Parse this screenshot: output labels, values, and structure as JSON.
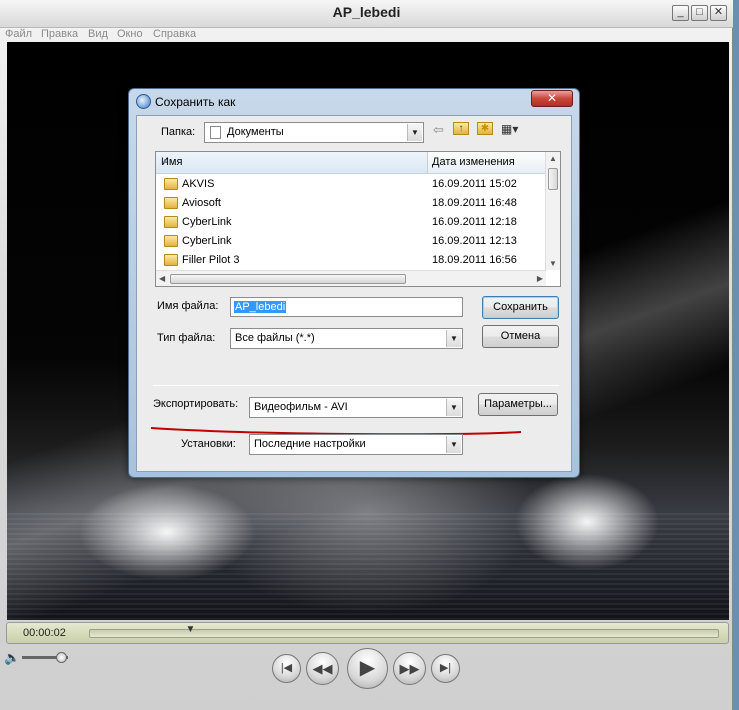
{
  "window": {
    "title": "AP_lebedi",
    "minimize": "_",
    "maximize": "□",
    "close": "✕"
  },
  "menu": [
    "Файл",
    "Правка",
    "Вид",
    "Окно",
    "Справка"
  ],
  "player": {
    "time": "00:00:02",
    "progress_fraction": 0.16,
    "volume_fraction": 0.85
  },
  "dialog": {
    "title": "Сохранить как",
    "close": "✕",
    "folder_label": "Папка:",
    "folder_value": "Документы",
    "columns": {
      "name": "Имя",
      "date": "Дата изменения"
    },
    "files": [
      {
        "name": "AKVIS",
        "date": "16.09.2011 15:02"
      },
      {
        "name": "Aviosoft",
        "date": "18.09.2011 16:48"
      },
      {
        "name": "CyberLink",
        "date": "16.09.2011 12:18"
      },
      {
        "name": "CyberLink",
        "date": "16.09.2011 12:13"
      },
      {
        "name": "Filler Pilot 3",
        "date": "18.09.2011 16:56"
      }
    ],
    "filename_label": "Имя файла:",
    "filename_value": "AP_lebedi",
    "filetype_label": "Тип файла:",
    "filetype_value": "Все файлы (*.*)",
    "save_button": "Сохранить",
    "cancel_button": "Отмена",
    "export_label": "Экспортировать:",
    "export_value": "Видеофильм - AVI",
    "params_button": "Параметры...",
    "settings_label": "Установки:",
    "settings_value": "Последние настройки"
  },
  "icons": {
    "back": "back-arrow-icon",
    "up": "up-folder-icon",
    "newfolder": "new-folder-icon",
    "views": "views-menu-icon",
    "doc": "document-icon",
    "volume": "speaker-icon",
    "rewind": "rewind-icon",
    "play": "play-icon",
    "forward": "fast-forward-icon",
    "prev": "skip-back-icon",
    "next": "skip-forward-icon"
  },
  "colors": {
    "annotation_line": "#c00000",
    "selection": "#3399ff",
    "dialog_frame": "#a9c2dc"
  }
}
